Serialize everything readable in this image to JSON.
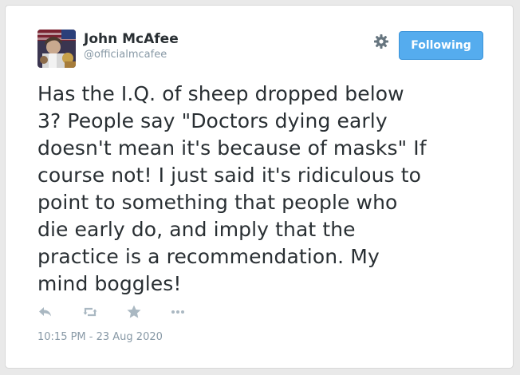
{
  "author": {
    "name": "John McAfee",
    "handle": "@officialmcafee"
  },
  "follow_button": {
    "label": "Following"
  },
  "tweet": {
    "text": "Has the I.Q. of sheep dropped below\n3? People say \"Doctors dying early\ndoesn't mean it's because of masks\" If\ncourse not! I just said it's ridiculous to\npoint to something that people who\ndie early do, and imply that the\npractice is a recommendation. My\nmind boggles!",
    "timestamp": "10:15 PM - 23 Aug 2020"
  },
  "icons": {
    "settings": "gear-icon",
    "reply": "reply-icon",
    "retweet": "retweet-icon",
    "favorite": "star-icon",
    "more": "more-icon"
  },
  "colors": {
    "accent": "#55acee",
    "text": "#292f33",
    "muted": "#8899a6",
    "icon": "#aab8c2"
  }
}
